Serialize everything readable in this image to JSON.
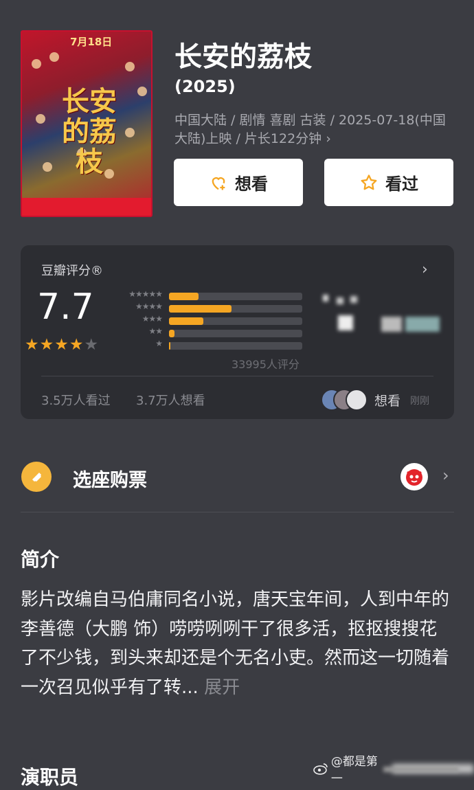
{
  "movie": {
    "poster_title": "长安的荔枝",
    "poster_date": "7月18日",
    "title": "长安的荔枝",
    "year": "(2025)",
    "meta": "中国大陆 / 剧情 喜剧 古装 / 2025-07-18(中国大陆)上映 / 片长122分钟 ›"
  },
  "actions": {
    "want_label": "想看",
    "seen_label": "看过"
  },
  "rating": {
    "label": "豆瓣评分®",
    "chevron": "›",
    "score": "7.7",
    "stars_on": "★★★★",
    "stars_off": "★",
    "stars_value": 4,
    "distribution": [
      {
        "stars": "★★★★★",
        "percent": 22
      },
      {
        "stars": "★★★★",
        "percent": 47
      },
      {
        "stars": "★★★",
        "percent": 26
      },
      {
        "stars": "★★",
        "percent": 4
      },
      {
        "stars": "★",
        "percent": 1
      }
    ],
    "count": "33995人评分",
    "seen": "3.5万人看过",
    "want": "3.7万人想看",
    "friends_action": "想看",
    "friends_time": "刚刚"
  },
  "ticket": {
    "label": "选座购票",
    "chevron": "›"
  },
  "intro": {
    "heading": "简介",
    "text": "影片改编自马伯庸同名小说，唐天宝年间，人到中年的李善德（大鹏 饰）唠唠咧咧干了很多活，抠抠搜搜花了不少钱，到头来却还是个无名小吏。然而这一切随着一次召见似乎有了转...",
    "more": "展开"
  },
  "cast": {
    "heading": "演职员"
  },
  "watermark": {
    "text": "@都是第一"
  },
  "colors": {
    "background": "#3b3c42",
    "card": "#2c2d32",
    "accent": "#f5a623"
  }
}
